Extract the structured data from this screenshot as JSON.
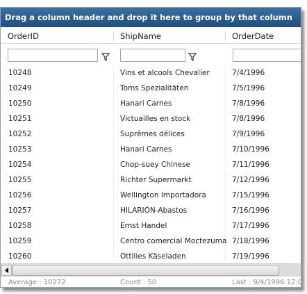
{
  "group_panel": {
    "text": "Drag a column header and drop it here to group by that column"
  },
  "columns": [
    {
      "header": "OrderID"
    },
    {
      "header": "ShipName"
    },
    {
      "header": "OrderDate"
    }
  ],
  "filter": {
    "orderid_value": "",
    "shipname_value": "",
    "orderdate_value": "",
    "icon": "filter-icon"
  },
  "rows": [
    {
      "order_id": "10248",
      "ship_name": "Vins et alcools Chevalier",
      "order_date": "7/4/1996"
    },
    {
      "order_id": "10249",
      "ship_name": "Toms Spezialitäten",
      "order_date": "7/5/1996"
    },
    {
      "order_id": "10250",
      "ship_name": "Hanari Carnes",
      "order_date": "7/8/1996"
    },
    {
      "order_id": "10251",
      "ship_name": "Victuailles en stock",
      "order_date": "7/8/1996"
    },
    {
      "order_id": "10252",
      "ship_name": "Suprêmes délices",
      "order_date": "7/9/1996"
    },
    {
      "order_id": "10253",
      "ship_name": "Hanari Carnes",
      "order_date": "7/10/1996"
    },
    {
      "order_id": "10254",
      "ship_name": "Chop-suey Chinese",
      "order_date": "7/11/1996"
    },
    {
      "order_id": "10255",
      "ship_name": "Richter Supermarkt",
      "order_date": "7/12/1996"
    },
    {
      "order_id": "10256",
      "ship_name": "Wellington Importadora",
      "order_date": "7/15/1996"
    },
    {
      "order_id": "10257",
      "ship_name": "HILARIÓN-Abastos",
      "order_date": "7/16/1996"
    },
    {
      "order_id": "10258",
      "ship_name": "Ernst Handel",
      "order_date": "7/17/1996"
    },
    {
      "order_id": "10259",
      "ship_name": "Centro comercial Moctezuma",
      "order_date": "7/18/1996"
    },
    {
      "order_id": "10260",
      "ship_name": "Ottilies Käseladen",
      "order_date": "7/19/1996"
    }
  ],
  "footer": {
    "average": "Average : 10272",
    "count": "Count : 50",
    "last": "Last : 9/4/1996 12:0"
  },
  "colors": {
    "group_panel": "#2b5c8c",
    "border": "#8aa4bd",
    "footer_text": "#8a8a8a"
  }
}
